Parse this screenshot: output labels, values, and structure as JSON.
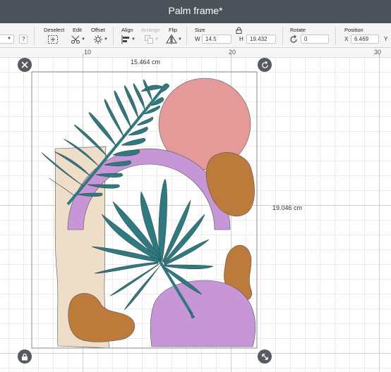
{
  "app": {
    "title": "Palm frame*"
  },
  "toolbar": {
    "help_label": "?",
    "deselect_label": "Deselect",
    "edit_label": "Edit",
    "offset_label": "Offset",
    "align_label": "Align",
    "arrange_label": "Arrange",
    "flip_label": "Flip",
    "size_label": "Size",
    "width_letter": "W",
    "width_value": "14.5",
    "height_letter": "H",
    "height_value": "19.432",
    "rotate_label": "Rotate",
    "rotate_value": "0",
    "position_label": "Position",
    "x_letter": "X",
    "x_value": "6.469",
    "y_letter": "Y"
  },
  "ruler": {
    "labels": [
      "10",
      "20",
      "30"
    ]
  },
  "canvas": {
    "width_dim": "15.464 cm",
    "height_dim": "19.046 cm"
  },
  "colors": {
    "teal": "#2f7a80",
    "lavender": "#c696d6",
    "peach": "#e49a98",
    "ochre": "#bd7b3b",
    "cream": "#eeddc9",
    "titlebar": "#4b525a"
  },
  "icons": {
    "close": "close-icon",
    "rotate": "rotate-handle-icon",
    "lock": "lock-icon",
    "resize": "resize-icon"
  }
}
